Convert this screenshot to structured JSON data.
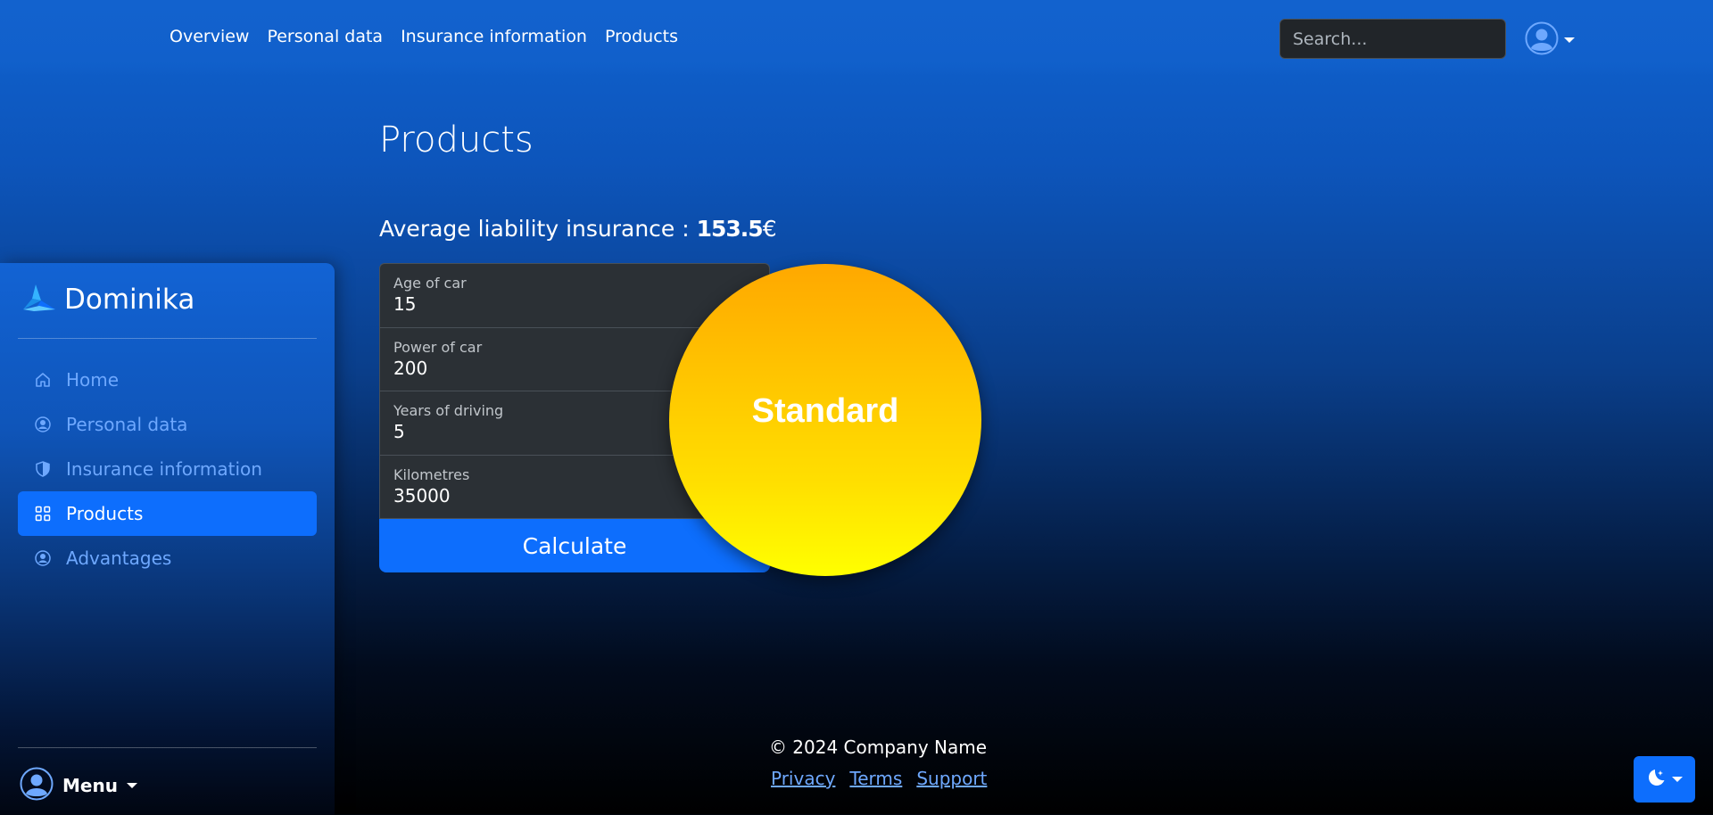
{
  "topnav": {
    "links": [
      "Overview",
      "Personal data",
      "Insurance information",
      "Products"
    ],
    "search_placeholder": "Search..."
  },
  "sidebar": {
    "brand": "Dominika",
    "items": [
      {
        "label": "Home",
        "icon": "house-icon"
      },
      {
        "label": "Personal data",
        "icon": "person-circle-icon"
      },
      {
        "label": "Insurance information",
        "icon": "shield-icon"
      },
      {
        "label": "Products",
        "icon": "grid-icon",
        "active": true
      },
      {
        "label": "Advantages",
        "icon": "person-circle-icon"
      }
    ],
    "menu_label": "Menu"
  },
  "main": {
    "title": "Products",
    "avg_label": "Average liability insurance : ",
    "avg_value": "153.5",
    "avg_currency": "€",
    "fields": [
      {
        "label": "Age of car",
        "value": "15"
      },
      {
        "label": "Power of car",
        "value": "200"
      },
      {
        "label": "Years of driving",
        "value": "5"
      },
      {
        "label": "Kilometres",
        "value": "35000"
      }
    ],
    "calculate_label": "Calculate",
    "result_badge": "Standard"
  },
  "footer": {
    "copyright": "© 2024 Company Name",
    "links": [
      "Privacy",
      "Terms",
      "Support"
    ]
  },
  "colors": {
    "accent": "#0d6efd",
    "link": "#6ea8fe",
    "badge_top": "#ffa800",
    "badge_bottom": "#ffff00"
  }
}
